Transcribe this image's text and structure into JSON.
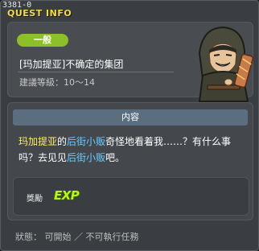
{
  "window": {
    "id": "3381-0",
    "title": "QUEST INFO"
  },
  "quest": {
    "category": "一般",
    "name": "[玛加提亚]不确定的集团",
    "required_level": "建議等級：10～14"
  },
  "content": {
    "header": "内容",
    "segments": [
      {
        "text": "玛加提亚",
        "style": "hl-yellow"
      },
      {
        "text": "的",
        "style": ""
      },
      {
        "text": "后街小贩",
        "style": "hl-cyan"
      },
      {
        "text": "奇怪地看着我……？有什么事吗？去见见",
        "style": ""
      },
      {
        "text": "后街小贩",
        "style": "hl-cyan"
      },
      {
        "text": "吧。",
        "style": ""
      }
    ]
  },
  "reward": {
    "label": "獎勵",
    "icon_text": "EXP",
    "icon_name": "exp-icon"
  },
  "status": {
    "text": "狀態： 可開始 ／ 不可執行任務"
  },
  "colors": {
    "title": "#f2d94b",
    "badge": "#8cbf2a",
    "npc_name": "#ffee66",
    "npc_ref": "#66ccff",
    "exp": "#b6f51d"
  }
}
